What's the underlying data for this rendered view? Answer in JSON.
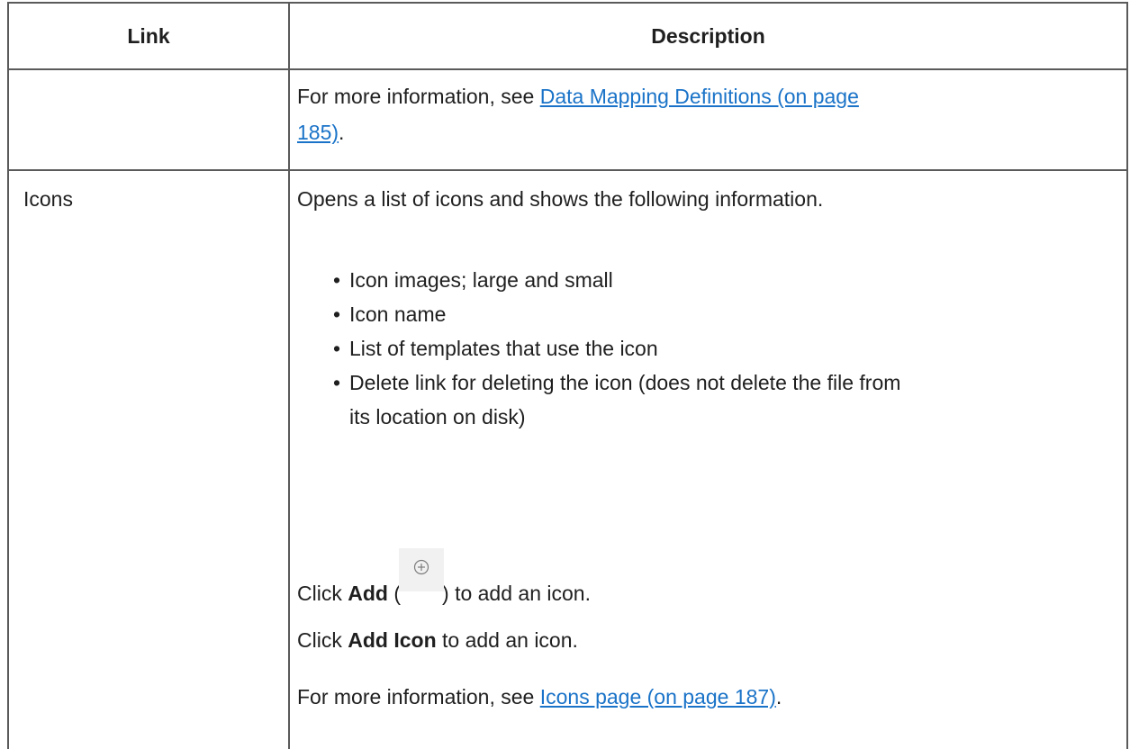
{
  "table": {
    "headers": {
      "link": "Link",
      "description": "Description"
    },
    "rows": [
      {
        "link": "",
        "description": {
          "prefix": "For more information, see ",
          "link_text_line1": "Data Mapping Definitions (on page",
          "link_text_line2": "185)",
          "suffix": "."
        }
      },
      {
        "link": "Icons",
        "description": {
          "intro": "Opens a list of icons and shows the following information.",
          "bullets": [
            "Icon images; large and small",
            "Icon name",
            "List of templates that use the icon",
            "Delete link for deleting the icon (does not delete the file from"
          ],
          "bullet_continuation": "its location on disk)",
          "add_prefix": "Click ",
          "add_bold": "Add",
          "add_open": " (",
          "add_icon": "plus-circle-icon",
          "add_suffix": ") to add an icon.",
          "addicon_prefix": "Click ",
          "addicon_bold": "Add Icon",
          "addicon_suffix": " to add an icon.",
          "more_prefix": "For more information, see ",
          "more_link": "Icons page (on page 187)",
          "more_suffix": "."
        }
      }
    ]
  },
  "colors": {
    "link": "#1a73c8",
    "border": "#5a5a5a",
    "text": "#1f1f1f"
  }
}
